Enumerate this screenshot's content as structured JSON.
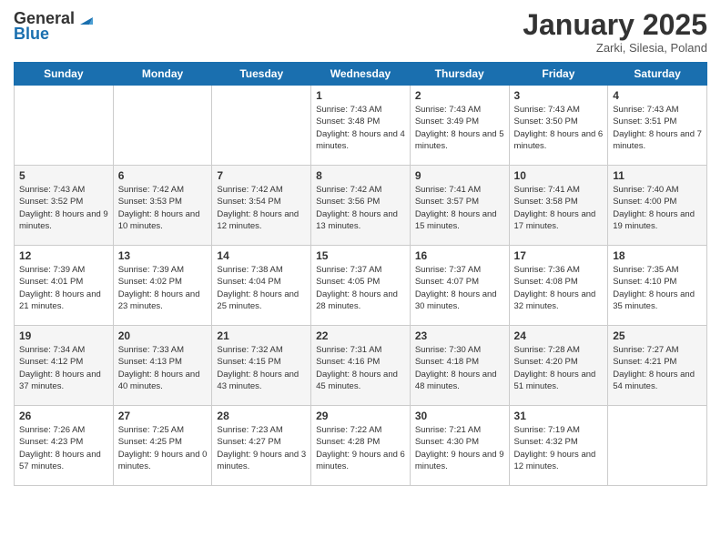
{
  "header": {
    "logo_general": "General",
    "logo_blue": "Blue",
    "month_title": "January 2025",
    "location": "Zarki, Silesia, Poland"
  },
  "columns": [
    "Sunday",
    "Monday",
    "Tuesday",
    "Wednesday",
    "Thursday",
    "Friday",
    "Saturday"
  ],
  "weeks": [
    [
      {
        "day": "",
        "info": ""
      },
      {
        "day": "",
        "info": ""
      },
      {
        "day": "",
        "info": ""
      },
      {
        "day": "1",
        "info": "Sunrise: 7:43 AM\nSunset: 3:48 PM\nDaylight: 8 hours and 4 minutes."
      },
      {
        "day": "2",
        "info": "Sunrise: 7:43 AM\nSunset: 3:49 PM\nDaylight: 8 hours and 5 minutes."
      },
      {
        "day": "3",
        "info": "Sunrise: 7:43 AM\nSunset: 3:50 PM\nDaylight: 8 hours and 6 minutes."
      },
      {
        "day": "4",
        "info": "Sunrise: 7:43 AM\nSunset: 3:51 PM\nDaylight: 8 hours and 7 minutes."
      }
    ],
    [
      {
        "day": "5",
        "info": "Sunrise: 7:43 AM\nSunset: 3:52 PM\nDaylight: 8 hours and 9 minutes."
      },
      {
        "day": "6",
        "info": "Sunrise: 7:42 AM\nSunset: 3:53 PM\nDaylight: 8 hours and 10 minutes."
      },
      {
        "day": "7",
        "info": "Sunrise: 7:42 AM\nSunset: 3:54 PM\nDaylight: 8 hours and 12 minutes."
      },
      {
        "day": "8",
        "info": "Sunrise: 7:42 AM\nSunset: 3:56 PM\nDaylight: 8 hours and 13 minutes."
      },
      {
        "day": "9",
        "info": "Sunrise: 7:41 AM\nSunset: 3:57 PM\nDaylight: 8 hours and 15 minutes."
      },
      {
        "day": "10",
        "info": "Sunrise: 7:41 AM\nSunset: 3:58 PM\nDaylight: 8 hours and 17 minutes."
      },
      {
        "day": "11",
        "info": "Sunrise: 7:40 AM\nSunset: 4:00 PM\nDaylight: 8 hours and 19 minutes."
      }
    ],
    [
      {
        "day": "12",
        "info": "Sunrise: 7:39 AM\nSunset: 4:01 PM\nDaylight: 8 hours and 21 minutes."
      },
      {
        "day": "13",
        "info": "Sunrise: 7:39 AM\nSunset: 4:02 PM\nDaylight: 8 hours and 23 minutes."
      },
      {
        "day": "14",
        "info": "Sunrise: 7:38 AM\nSunset: 4:04 PM\nDaylight: 8 hours and 25 minutes."
      },
      {
        "day": "15",
        "info": "Sunrise: 7:37 AM\nSunset: 4:05 PM\nDaylight: 8 hours and 28 minutes."
      },
      {
        "day": "16",
        "info": "Sunrise: 7:37 AM\nSunset: 4:07 PM\nDaylight: 8 hours and 30 minutes."
      },
      {
        "day": "17",
        "info": "Sunrise: 7:36 AM\nSunset: 4:08 PM\nDaylight: 8 hours and 32 minutes."
      },
      {
        "day": "18",
        "info": "Sunrise: 7:35 AM\nSunset: 4:10 PM\nDaylight: 8 hours and 35 minutes."
      }
    ],
    [
      {
        "day": "19",
        "info": "Sunrise: 7:34 AM\nSunset: 4:12 PM\nDaylight: 8 hours and 37 minutes."
      },
      {
        "day": "20",
        "info": "Sunrise: 7:33 AM\nSunset: 4:13 PM\nDaylight: 8 hours and 40 minutes."
      },
      {
        "day": "21",
        "info": "Sunrise: 7:32 AM\nSunset: 4:15 PM\nDaylight: 8 hours and 43 minutes."
      },
      {
        "day": "22",
        "info": "Sunrise: 7:31 AM\nSunset: 4:16 PM\nDaylight: 8 hours and 45 minutes."
      },
      {
        "day": "23",
        "info": "Sunrise: 7:30 AM\nSunset: 4:18 PM\nDaylight: 8 hours and 48 minutes."
      },
      {
        "day": "24",
        "info": "Sunrise: 7:28 AM\nSunset: 4:20 PM\nDaylight: 8 hours and 51 minutes."
      },
      {
        "day": "25",
        "info": "Sunrise: 7:27 AM\nSunset: 4:21 PM\nDaylight: 8 hours and 54 minutes."
      }
    ],
    [
      {
        "day": "26",
        "info": "Sunrise: 7:26 AM\nSunset: 4:23 PM\nDaylight: 8 hours and 57 minutes."
      },
      {
        "day": "27",
        "info": "Sunrise: 7:25 AM\nSunset: 4:25 PM\nDaylight: 9 hours and 0 minutes."
      },
      {
        "day": "28",
        "info": "Sunrise: 7:23 AM\nSunset: 4:27 PM\nDaylight: 9 hours and 3 minutes."
      },
      {
        "day": "29",
        "info": "Sunrise: 7:22 AM\nSunset: 4:28 PM\nDaylight: 9 hours and 6 minutes."
      },
      {
        "day": "30",
        "info": "Sunrise: 7:21 AM\nSunset: 4:30 PM\nDaylight: 9 hours and 9 minutes."
      },
      {
        "day": "31",
        "info": "Sunrise: 7:19 AM\nSunset: 4:32 PM\nDaylight: 9 hours and 12 minutes."
      },
      {
        "day": "",
        "info": ""
      }
    ]
  ]
}
